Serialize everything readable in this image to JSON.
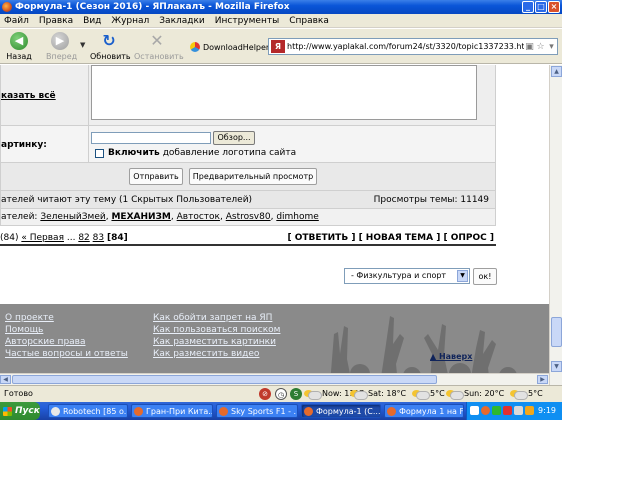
{
  "window": {
    "title": "Формула-1 (Сезон 2016) - ЯПлакалъ - Mozilla Firefox",
    "minimize": "_",
    "maximize": "□",
    "close": "×"
  },
  "menu": [
    "Файл",
    "Правка",
    "Вид",
    "Журнал",
    "Закладки",
    "Инструменты",
    "Справка"
  ],
  "toolbar": {
    "back": "Назад",
    "forward": "Вперед",
    "reload": "Обновить",
    "stop": "Остановить",
    "download_helper": "DownloadHelper",
    "url": "http://www.yaplakal.com/forum24/st/3320/topic1337233.html#ent"
  },
  "page": {
    "show_all": "казать всё",
    "picture_label": "артинку:",
    "browse_button": "Обзор...",
    "logo_checkbox_bold": "Включить",
    "logo_checkbox_rest": "добавление логотипа сайта",
    "send_button": "Отправить",
    "preview_button": "Предварительный просмотр",
    "readers_text": "ателей читают эту тему (1 Скрытых Пользователей)",
    "views_text": "Просмотры темы: 11149",
    "users_prefix": "ателей:",
    "users": [
      "ЗеленыйЗмей",
      "МЕХАНИЗМ",
      "Автосток",
      "Astrosv80",
      "dimhome"
    ],
    "pager_prefix": "(84)",
    "pager_first": "« Первая",
    "pager_ellipsis": "...",
    "pager_pages": [
      "82",
      "83"
    ],
    "pager_current": "[84]",
    "actions": "[ ОТВЕТИТЬ ] [ НОВАЯ ТЕМА ] [ ОПРОС ]",
    "forum_select": "- Физкультура и спорт",
    "ok_button": "ок!"
  },
  "footer": {
    "left_links": [
      "О проекте",
      "Помощь",
      "Авторские права",
      "Частые вопросы и ответы"
    ],
    "right_links": [
      "Как обойти запрет на ЯП",
      "Как пользоваться поиском",
      "Как разместить картинки",
      "Как разместить видео"
    ],
    "back_to_top": "▲ Наверх"
  },
  "status": {
    "text": "Готово",
    "weather": [
      {
        "label": "Now: 11°C"
      },
      {
        "label": "Sat: 18°C"
      },
      {
        "label": "5°C"
      },
      {
        "label": "Sun: 20°C"
      },
      {
        "label": "5°C"
      }
    ]
  },
  "taskbar": {
    "start": "Пуск",
    "tasks": [
      {
        "label": "Robotech [85 o..."
      },
      {
        "label": "Гран-При Кита..."
      },
      {
        "label": "Sky Sports F1 - ..."
      },
      {
        "label": "Формула-1 (С..."
      },
      {
        "label": "Формула 1 на F..."
      }
    ],
    "clock": "9:19"
  },
  "colors": {
    "titlebar": "#0a55d8",
    "footer_bg": "#8a8a8a",
    "footer_link": "#e8eef8",
    "taskbar": "#245edb",
    "start": "#3c9b3c"
  }
}
